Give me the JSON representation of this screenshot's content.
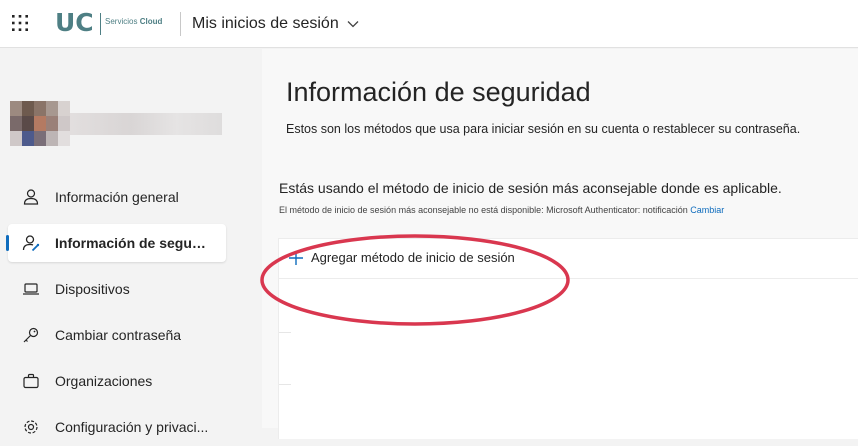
{
  "header": {
    "logo": {
      "text": "UC",
      "subtitle_plain": "Servicios",
      "subtitle_bold": "Cloud"
    },
    "app_title": "Mis inicios de sesión",
    "icons": {
      "waffle": "app-launcher-icon",
      "chevron": "chevron-down-icon"
    }
  },
  "sidebar": {
    "items": [
      {
        "label": "Información general",
        "icon": "person-icon",
        "active": false
      },
      {
        "label": "Información de seguri...",
        "icon": "person-key-icon",
        "active": true
      },
      {
        "label": "Dispositivos",
        "icon": "laptop-icon",
        "active": false
      },
      {
        "label": "Cambiar contraseña",
        "icon": "key-icon",
        "active": false
      },
      {
        "label": "Organizaciones",
        "icon": "briefcase-icon",
        "active": false
      },
      {
        "label": "Configuración y privaci...",
        "icon": "gear-icon",
        "active": false
      }
    ]
  },
  "main": {
    "title": "Información de seguridad",
    "subtitle": "Estos son los métodos que usa para iniciar sesión en su cuenta o restablecer su contraseña.",
    "default_method_line": "Estás usando el método de inicio de sesión más aconsejable donde es aplicable.",
    "default_method_note": "El método de inicio de sesión más aconsejable no está disponible: Microsoft Authenticator: notificación",
    "change_link": "Cambiar",
    "add_method_label": "Agregar método de inicio de sesión"
  },
  "colors": {
    "accent": "#0f6cbd",
    "logo": "#4e7f84",
    "annotation": "#d9374f"
  }
}
